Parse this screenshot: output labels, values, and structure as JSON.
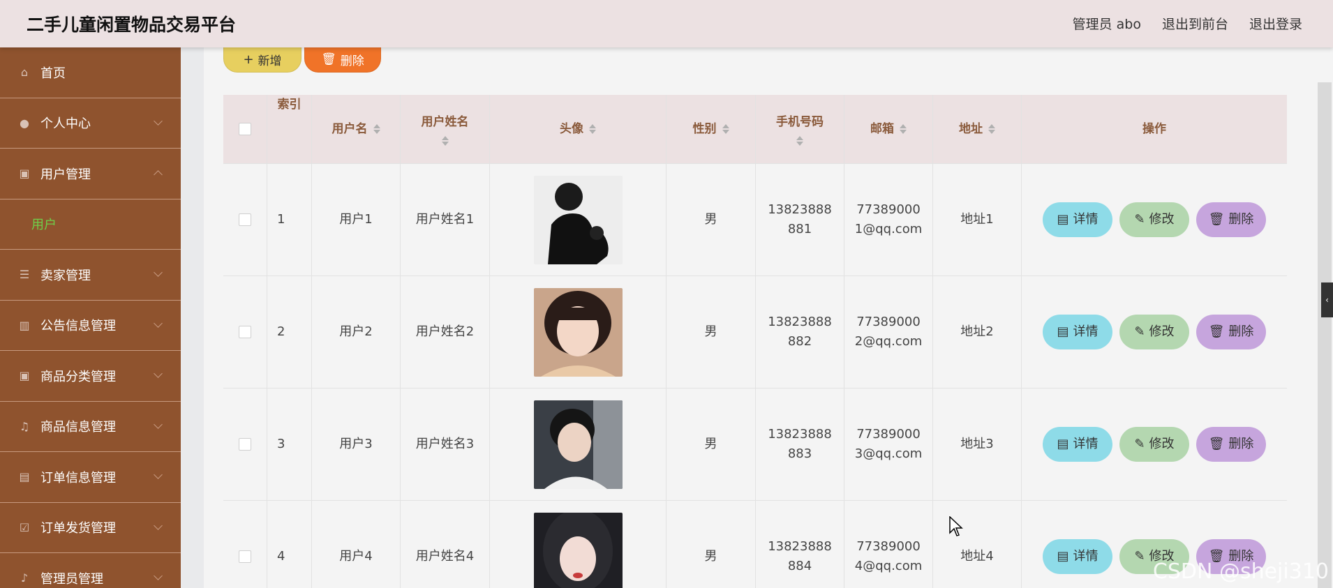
{
  "header": {
    "title": "二手儿童闲置物品交易平台",
    "admin": "管理员 abo",
    "front": "退出到前台",
    "logout": "退出登录"
  },
  "sidebar": {
    "items": [
      {
        "label": "首页",
        "icon": "home-icon"
      },
      {
        "label": "个人中心",
        "icon": "user-icon"
      },
      {
        "label": "用户管理",
        "icon": "clipboard-icon",
        "expanded": true
      },
      {
        "label": "卖家管理",
        "icon": "sliders-icon"
      },
      {
        "label": "公告信息管理",
        "icon": "bar-chart-icon"
      },
      {
        "label": "商品分类管理",
        "icon": "clipboard-icon"
      },
      {
        "label": "商品信息管理",
        "icon": "bell-icon"
      },
      {
        "label": "订单信息管理",
        "icon": "document-icon"
      },
      {
        "label": "订单发货管理",
        "icon": "check-square-icon"
      },
      {
        "label": "管理员管理",
        "icon": "mic-icon"
      }
    ],
    "sub_item": "用户"
  },
  "toolbar": {
    "add": "新增",
    "delete": "删除"
  },
  "table": {
    "headers": {
      "index": "索引",
      "username": "用户名",
      "realname": "用户姓名",
      "avatar": "头像",
      "sex": "性别",
      "phone": "手机号码",
      "email": "邮箱",
      "address": "地址",
      "ops": "操作"
    },
    "rows": [
      {
        "index": "1",
        "username": "用户1",
        "realname": "用户姓名1",
        "sex": "男",
        "phone": "13823888881",
        "email": "773890001@qq.com",
        "address": "地址1"
      },
      {
        "index": "2",
        "username": "用户2",
        "realname": "用户姓名2",
        "sex": "男",
        "phone": "13823888882",
        "email": "773890002@qq.com",
        "address": "地址2"
      },
      {
        "index": "3",
        "username": "用户3",
        "realname": "用户姓名3",
        "sex": "男",
        "phone": "13823888883",
        "email": "773890003@qq.com",
        "address": "地址3"
      },
      {
        "index": "4",
        "username": "用户4",
        "realname": "用户姓名4",
        "sex": "男",
        "phone": "13823888884",
        "email": "773890004@qq.com",
        "address": "地址4"
      }
    ],
    "actions": {
      "detail": "详情",
      "edit": "修改",
      "remove": "删除"
    }
  },
  "watermark": "CSDN @sheji310"
}
